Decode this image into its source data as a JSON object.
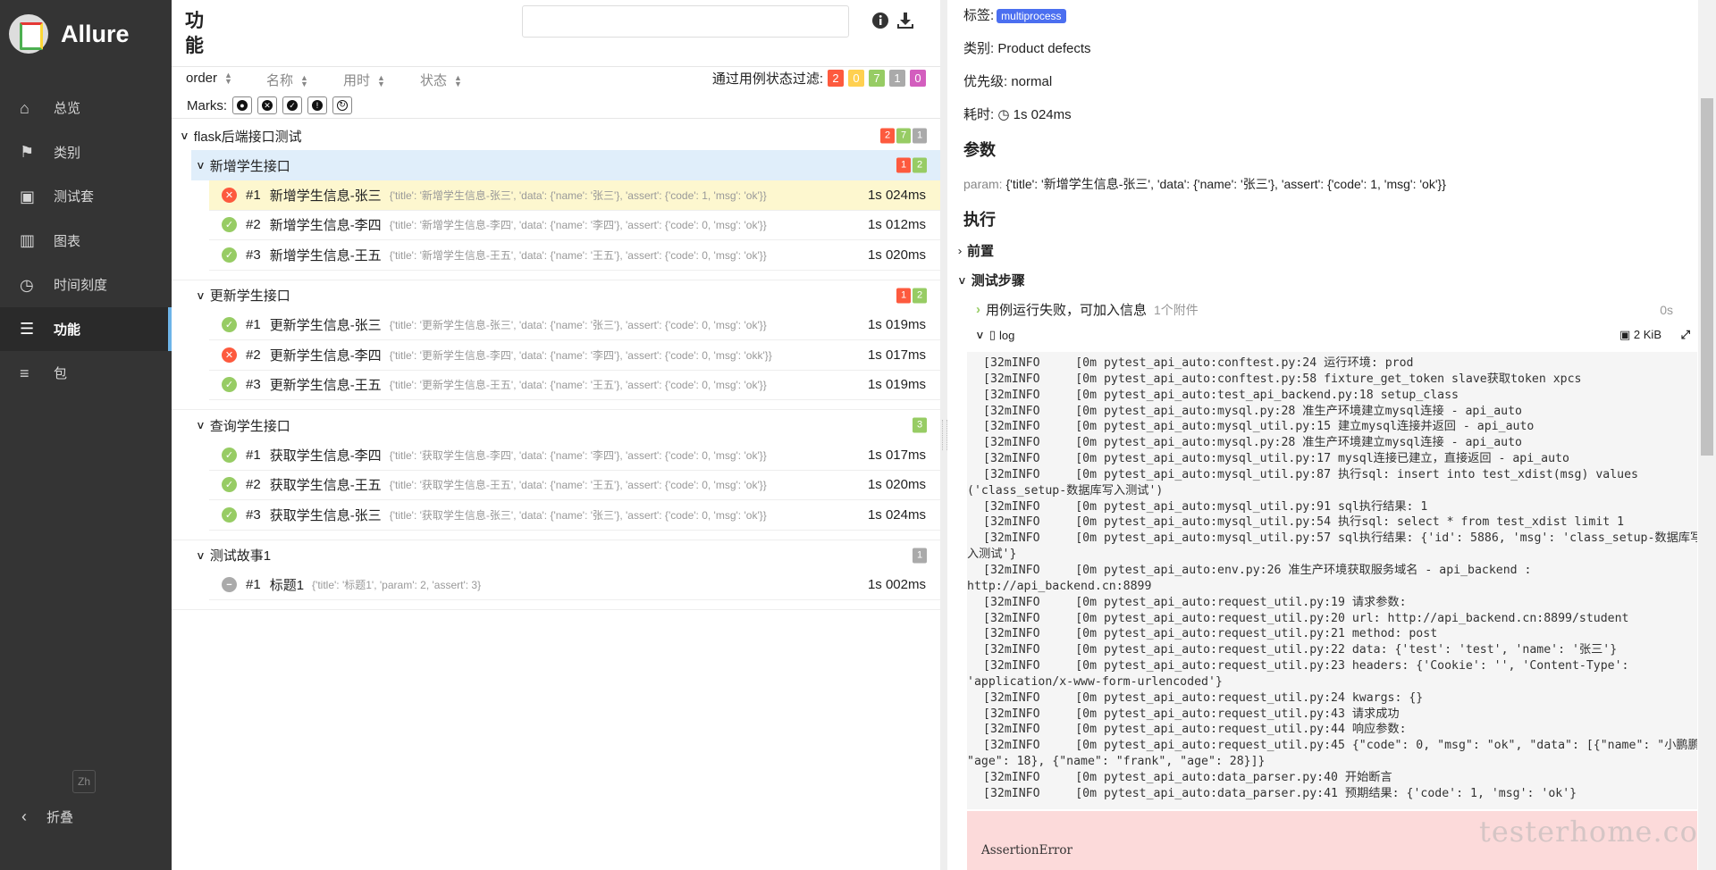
{
  "app": {
    "title": "Allure",
    "lang": "Zh",
    "collapse_label": "折叠"
  },
  "sidebar": {
    "items": [
      {
        "label": "总览",
        "icon": "home-icon"
      },
      {
        "label": "类别",
        "icon": "flag-icon"
      },
      {
        "label": "测试套",
        "icon": "briefcase-icon"
      },
      {
        "label": "图表",
        "icon": "bar-chart-icon"
      },
      {
        "label": "时间刻度",
        "icon": "clock-icon"
      },
      {
        "label": "功能",
        "icon": "list-icon",
        "active": true
      },
      {
        "label": "包",
        "icon": "align-left-icon"
      }
    ]
  },
  "header": {
    "title_line1": "功",
    "title_line2": "能",
    "search_value": ""
  },
  "sort": {
    "order": "order",
    "name": "名称",
    "duration": "用时",
    "status": "状态"
  },
  "filter": {
    "label": "通过用例状态过滤:",
    "failed": "2",
    "broken": "0",
    "passed": "7",
    "skipped": "1",
    "unknown": "0"
  },
  "marks": {
    "label": "Marks:"
  },
  "tree": {
    "root": {
      "name": "flask后端接口测试",
      "failed": "2",
      "passed": "7",
      "skipped": "1"
    },
    "groups": [
      {
        "name": "新增学生接口",
        "failed": "1",
        "passed": "2",
        "cases": [
          {
            "num": "#1",
            "name": "新增学生信息-张三",
            "params": "{'title': '新增学生信息-张三', 'data': {'name': '张三'}, 'assert': {'code': 1, 'msg': 'ok'}}",
            "dur": "1s 024ms",
            "status": "failed",
            "selected": true
          },
          {
            "num": "#2",
            "name": "新增学生信息-李四",
            "params": "{'title': '新增学生信息-李四', 'data': {'name': '李四'}, 'assert': {'code': 0, 'msg': 'ok'}}",
            "dur": "1s 012ms",
            "status": "passed"
          },
          {
            "num": "#3",
            "name": "新增学生信息-王五",
            "params": "{'title': '新增学生信息-王五', 'data': {'name': '王五'}, 'assert': {'code': 0, 'msg': 'ok'}}",
            "dur": "1s 020ms",
            "status": "passed"
          }
        ]
      },
      {
        "name": "更新学生接口",
        "failed": "1",
        "passed": "2",
        "cases": [
          {
            "num": "#1",
            "name": "更新学生信息-张三",
            "params": "{'title': '更新学生信息-张三', 'data': {'name': '张三'}, 'assert': {'code': 0, 'msg': 'ok'}}",
            "dur": "1s 019ms",
            "status": "passed"
          },
          {
            "num": "#2",
            "name": "更新学生信息-李四",
            "params": "{'title': '更新学生信息-李四', 'data': {'name': '李四'}, 'assert': {'code': 0, 'msg': 'okk'}}",
            "dur": "1s 017ms",
            "status": "failed"
          },
          {
            "num": "#3",
            "name": "更新学生信息-王五",
            "params": "{'title': '更新学生信息-王五', 'data': {'name': '王五'}, 'assert': {'code': 0, 'msg': 'ok'}}",
            "dur": "1s 019ms",
            "status": "passed"
          }
        ]
      },
      {
        "name": "查询学生接口",
        "passed": "3",
        "cases": [
          {
            "num": "#1",
            "name": "获取学生信息-李四",
            "params": "{'title': '获取学生信息-李四', 'data': {'name': '李四'}, 'assert': {'code': 0, 'msg': 'ok'}}",
            "dur": "1s 017ms",
            "status": "passed"
          },
          {
            "num": "#2",
            "name": "获取学生信息-王五",
            "params": "{'title': '获取学生信息-王五', 'data': {'name': '王五'}, 'assert': {'code': 0, 'msg': 'ok'}}",
            "dur": "1s 020ms",
            "status": "passed"
          },
          {
            "num": "#3",
            "name": "获取学生信息-张三",
            "params": "{'title': '获取学生信息-张三', 'data': {'name': '张三'}, 'assert': {'code': 0, 'msg': 'ok'}}",
            "dur": "1s 024ms",
            "status": "passed"
          }
        ]
      },
      {
        "name": "测试故事1",
        "skipped": "1",
        "cases": [
          {
            "num": "#1",
            "name": "标题1",
            "params": "{'title': '标题1', 'param': 2, 'assert': 3}",
            "dur": "1s 002ms",
            "status": "skipped"
          }
        ]
      }
    ]
  },
  "detail": {
    "tag_label": "标签:",
    "tag_value": "multiprocess",
    "category": "类别: Product defects",
    "severity": "优先级: normal",
    "duration_label": "耗时:",
    "duration_value": "1s 024ms",
    "params_title": "参数",
    "param_name": "param:",
    "param_value": "{'title': '新增学生信息-张三', 'data': {'name': '张三'}, 'assert': {'code': 1, 'msg': 'ok'}}",
    "exec_title": "执行",
    "setup_label": "前置",
    "steps_label": "测试步骤",
    "step1_label": "用例运行失败，可加入信息",
    "step1_attach": "1个附件",
    "step1_time": "0s",
    "log_label": "log",
    "log_size": "2 KiB",
    "log_lines": [
      "[32mINFO     [0m pytest_api_auto:conftest.py:24 运行环境: prod",
      "[32mINFO     [0m pytest_api_auto:conftest.py:58 fixture_get_token slave获取token xpcs",
      "[32mINFO     [0m pytest_api_auto:test_api_backend.py:18 setup_class",
      "[32mINFO     [0m pytest_api_auto:mysql.py:28 准生产环境建立mysql连接 - api_auto",
      "[32mINFO     [0m pytest_api_auto:mysql_util.py:15 建立mysql连接并返回 - api_auto",
      "[32mINFO     [0m pytest_api_auto:mysql.py:28 准生产环境建立mysql连接 - api_auto",
      "[32mINFO     [0m pytest_api_auto:mysql_util.py:17 mysql连接已建立，直接返回 - api_auto",
      "[32mINFO     [0m pytest_api_auto:mysql_util.py:87 执行sql: insert into test_xdist(msg) values",
      "('class_setup-数据库写入测试')",
      "[32mINFO     [0m pytest_api_auto:mysql_util.py:91 sql执行结果: 1",
      "[32mINFO     [0m pytest_api_auto:mysql_util.py:54 执行sql: select * from test_xdist limit 1",
      "[32mINFO     [0m pytest_api_auto:mysql_util.py:57 sql执行结果: {'id': 5886, 'msg': 'class_setup-数据库写",
      "入测试'}",
      "[32mINFO     [0m pytest_api_auto:env.py:26 准生产环境获取服务域名 - api_backend :",
      "http://api_backend.cn:8899",
      "[32mINFO     [0m pytest_api_auto:request_util.py:19 请求参数:",
      "[32mINFO     [0m pytest_api_auto:request_util.py:20 url: http://api_backend.cn:8899/student",
      "[32mINFO     [0m pytest_api_auto:request_util.py:21 method: post",
      "[32mINFO     [0m pytest_api_auto:request_util.py:22 data: {'test': 'test', 'name': '张三'}",
      "[32mINFO     [0m pytest_api_auto:request_util.py:23 headers: {'Cookie': '', 'Content-Type':",
      "'application/x-www-form-urlencoded'}",
      "[32mINFO     [0m pytest_api_auto:request_util.py:24 kwargs: {}",
      "[32mINFO     [0m pytest_api_auto:request_util.py:43 请求成功",
      "[32mINFO     [0m pytest_api_auto:request_util.py:44 响应参数:",
      "[32mINFO     [0m pytest_api_auto:request_util.py:45 {\"code\": 0, \"msg\": \"ok\", \"data\": [{\"name\": \"小鹏鹏\",",
      "\"age\": 18}, {\"name\": \"frank\", \"age\": 28}]}",
      "[32mINFO     [0m pytest_api_auto:data_parser.py:40 开始断言",
      "[32mINFO     [0m pytest_api_auto:data_parser.py:41 预期结果: {'code': 1, 'msg': 'ok'}"
    ],
    "assertion": "AssertionError",
    "watermark": "testerhome.com"
  },
  "colors": {
    "failed": "#fd5a3e",
    "broken": "#ffd050",
    "passed": "#97cc64",
    "skipped": "#aaaaaa",
    "unknown": "#d35ebe",
    "tag": "#4b6ff0"
  }
}
